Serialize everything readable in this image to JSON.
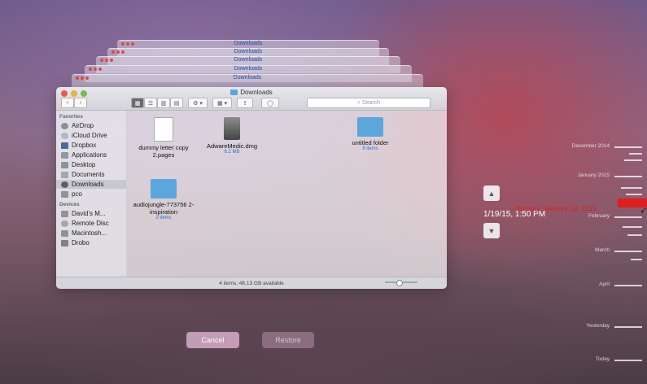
{
  "window": {
    "title": "Downloads",
    "search_placeholder": "Search",
    "toolbar_action": "⚙ ▾",
    "toolbar_arrange": "▦ ▾",
    "status": "4 items, 48.13 GB available"
  },
  "sidebar": {
    "favorites_header": "Favorites",
    "devices_header": "Devices",
    "favorites": [
      {
        "label": "AirDrop"
      },
      {
        "label": "iCloud Drive"
      },
      {
        "label": "Dropbox"
      },
      {
        "label": "Applications"
      },
      {
        "label": "Desktop"
      },
      {
        "label": "Documents"
      },
      {
        "label": "Downloads"
      },
      {
        "label": "pco"
      }
    ],
    "devices": [
      {
        "label": "David's M..."
      },
      {
        "label": "Remote Disc"
      },
      {
        "label": "Macintosh..."
      },
      {
        "label": "Drobo"
      }
    ]
  },
  "files": [
    {
      "name": "dummy letter copy 2.pages",
      "meta": ""
    },
    {
      "name": "AdwareMedic.dmg",
      "meta": "6.2 MB"
    },
    {
      "name": "untitled folder",
      "meta": "9 items"
    },
    {
      "name": "audiojungle-773756 2-inspiration",
      "meta": "2 items"
    }
  ],
  "buttons": {
    "cancel": "Cancel",
    "restore": "Restore"
  },
  "timemachine": {
    "snapshot_datetime": "1/19/15, 1:50 PM",
    "hover_label": "Monday, January 19, 2015",
    "timeline_labels": [
      "December 2014",
      "January 2015",
      "February",
      "March",
      "April",
      "Yesterday",
      "Today"
    ],
    "accent_color": "#e31c1c"
  }
}
